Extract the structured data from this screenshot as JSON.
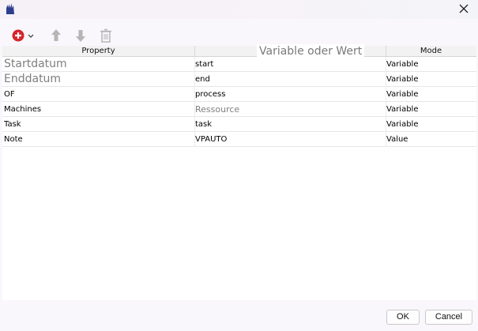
{
  "window": {
    "title": ""
  },
  "toolbar": {
    "add_icon": "add-circle-icon",
    "up_icon": "arrow-up-icon",
    "down_icon": "arrow-down-icon",
    "delete_icon": "trash-icon"
  },
  "table": {
    "columns": [
      "Property",
      "",
      "Mode"
    ],
    "value_overlay": "Variable oder Wert",
    "rows": [
      {
        "property": "Startdatum",
        "value": "start",
        "mode": "Variable"
      },
      {
        "property": "Enddatum",
        "value": "end",
        "mode": "Variable"
      },
      {
        "property": "OF",
        "value": "process",
        "mode": "Variable"
      },
      {
        "property": "Machines",
        "value": "Ressource",
        "mode": "Variable"
      },
      {
        "property": "Task",
        "value": "task",
        "mode": "Variable"
      },
      {
        "property": "Note",
        "value": "VPAUTO",
        "mode": "Value"
      }
    ]
  },
  "buttons": {
    "ok": "OK",
    "cancel": "Cancel"
  },
  "colors": {
    "add_red": "#d6262b",
    "arrow_gray": "#b5b5b5"
  }
}
